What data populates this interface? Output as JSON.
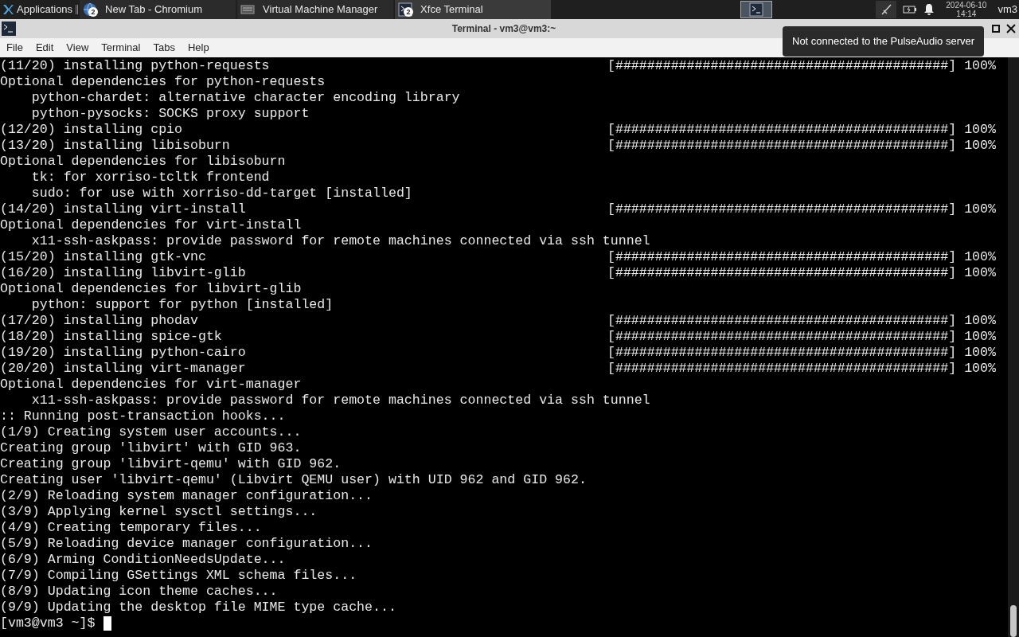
{
  "taskbar": {
    "apps_label": "Applications",
    "tasks": [
      {
        "label": "New Tab - Chromium",
        "kind": "browser",
        "badge": "2",
        "selected": false
      },
      {
        "label": "Virtual Machine Manager",
        "kind": "vm",
        "selected": false
      },
      {
        "label": "Xfce Terminal",
        "kind": "terminal",
        "badge": "2",
        "selected": true
      }
    ],
    "date": "2024-06-10",
    "time": "14:14",
    "user": "vm3"
  },
  "window": {
    "title": "Terminal - vm3@vm3:~"
  },
  "menu": [
    "File",
    "Edit",
    "View",
    "Terminal",
    "Tabs",
    "Help"
  ],
  "tooltip": "Not connected to the PulseAudio server",
  "lines": [
    {
      "kind": "progress",
      "text": "(11/20) installing python-requests",
      "bar": "[##########################################]",
      "percent": "100%"
    },
    {
      "kind": "text",
      "text": "Optional dependencies for python-requests"
    },
    {
      "kind": "text",
      "text": "    python-chardet: alternative character encoding library"
    },
    {
      "kind": "text",
      "text": "    python-pysocks: SOCKS proxy support"
    },
    {
      "kind": "progress",
      "text": "(12/20) installing cpio",
      "bar": "[##########################################]",
      "percent": "100%"
    },
    {
      "kind": "progress",
      "text": "(13/20) installing libisoburn",
      "bar": "[##########################################]",
      "percent": "100%"
    },
    {
      "kind": "text",
      "text": "Optional dependencies for libisoburn"
    },
    {
      "kind": "text",
      "text": "    tk: for xorriso-tcltk frontend"
    },
    {
      "kind": "text",
      "text": "    sudo: for use with xorriso-dd-target [installed]"
    },
    {
      "kind": "progress",
      "text": "(14/20) installing virt-install",
      "bar": "[##########################################]",
      "percent": "100%"
    },
    {
      "kind": "text",
      "text": "Optional dependencies for virt-install"
    },
    {
      "kind": "text",
      "text": "    x11-ssh-askpass: provide password for remote machines connected via ssh tunnel"
    },
    {
      "kind": "progress",
      "text": "(15/20) installing gtk-vnc",
      "bar": "[##########################################]",
      "percent": "100%"
    },
    {
      "kind": "progress",
      "text": "(16/20) installing libvirt-glib",
      "bar": "[##########################################]",
      "percent": "100%"
    },
    {
      "kind": "text",
      "text": "Optional dependencies for libvirt-glib"
    },
    {
      "kind": "text",
      "text": "    python: support for python [installed]"
    },
    {
      "kind": "progress",
      "text": "(17/20) installing phodav",
      "bar": "[##########################################]",
      "percent": "100%"
    },
    {
      "kind": "progress",
      "text": "(18/20) installing spice-gtk",
      "bar": "[##########################################]",
      "percent": "100%"
    },
    {
      "kind": "progress",
      "text": "(19/20) installing python-cairo",
      "bar": "[##########################################]",
      "percent": "100%"
    },
    {
      "kind": "progress",
      "text": "(20/20) installing virt-manager",
      "bar": "[##########################################]",
      "percent": "100%"
    },
    {
      "kind": "text",
      "text": "Optional dependencies for virt-manager"
    },
    {
      "kind": "text",
      "text": "    x11-ssh-askpass: provide password for remote machines connected via ssh tunnel"
    },
    {
      "kind": "text",
      "text": ":: Running post-transaction hooks..."
    },
    {
      "kind": "text",
      "text": "(1/9) Creating system user accounts..."
    },
    {
      "kind": "text",
      "text": "Creating group 'libvirt' with GID 963."
    },
    {
      "kind": "text",
      "text": "Creating group 'libvirt-qemu' with GID 962."
    },
    {
      "kind": "text",
      "text": "Creating user 'libvirt-qemu' (Libvirt QEMU user) with UID 962 and GID 962."
    },
    {
      "kind": "text",
      "text": "(2/9) Reloading system manager configuration..."
    },
    {
      "kind": "text",
      "text": "(3/9) Applying kernel sysctl settings..."
    },
    {
      "kind": "text",
      "text": "(4/9) Creating temporary files..."
    },
    {
      "kind": "text",
      "text": "(5/9) Reloading device manager configuration..."
    },
    {
      "kind": "text",
      "text": "(6/9) Arming ConditionNeedsUpdate..."
    },
    {
      "kind": "text",
      "text": "(7/9) Compiling GSettings XML schema files..."
    },
    {
      "kind": "text",
      "text": "(8/9) Updating icon theme caches..."
    },
    {
      "kind": "text",
      "text": "(9/9) Updating the desktop file MIME type cache..."
    }
  ],
  "prompt": "[vm3@vm3 ~]$"
}
